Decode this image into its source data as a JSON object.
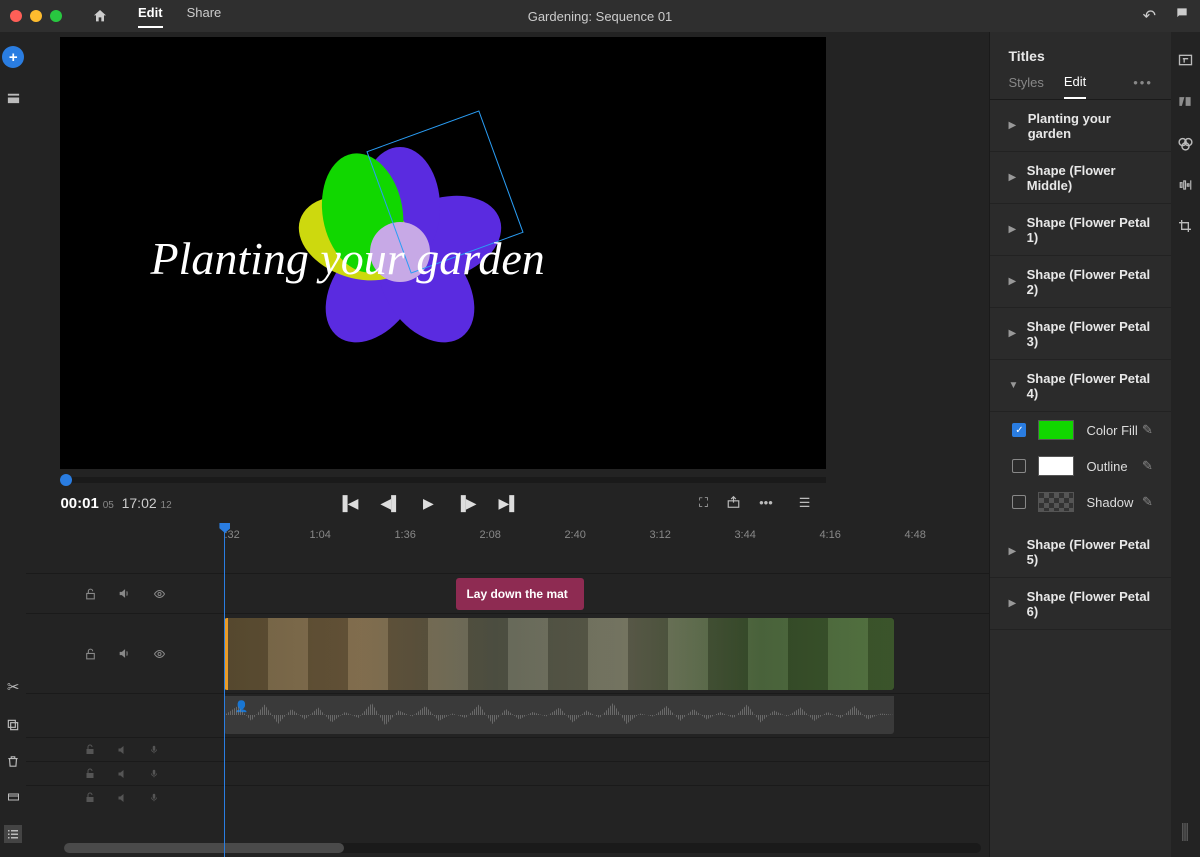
{
  "titlebar": {
    "title": "Gardening: Sequence 01",
    "menu": {
      "edit": "Edit",
      "share": "Share"
    }
  },
  "preview": {
    "title_text": "Planting your garden"
  },
  "transport": {
    "current_time": "00:01",
    "current_frame": "05",
    "total_time": "17:02",
    "total_frame": "12"
  },
  "ruler": {
    "marks": [
      ":32",
      "1:04",
      "1:36",
      "2:08",
      "2:40",
      "3:12",
      "3:44",
      "4:16",
      "4:48"
    ]
  },
  "timeline": {
    "title_clip_label": "Lay down the mat"
  },
  "right_panel": {
    "title": "Titles",
    "tabs": {
      "styles": "Styles",
      "edit": "Edit"
    },
    "layers": [
      {
        "name": "Planting your garden",
        "expanded": false
      },
      {
        "name": "Shape (Flower Middle)",
        "expanded": false
      },
      {
        "name": "Shape (Flower Petal 1)",
        "expanded": false
      },
      {
        "name": "Shape (Flower Petal 2)",
        "expanded": false
      },
      {
        "name": "Shape (Flower Petal 3)",
        "expanded": false
      },
      {
        "name": "Shape (Flower Petal 4)",
        "expanded": true
      },
      {
        "name": "Shape (Flower Petal 5)",
        "expanded": false
      },
      {
        "name": "Shape (Flower Petal 6)",
        "expanded": false
      }
    ],
    "props": {
      "color_fill": {
        "label": "Color Fill",
        "checked": true,
        "color": "#11d700"
      },
      "outline": {
        "label": "Outline",
        "checked": false,
        "color": "#ffffff"
      },
      "shadow": {
        "label": "Shadow",
        "checked": false,
        "color": "checker"
      }
    }
  }
}
